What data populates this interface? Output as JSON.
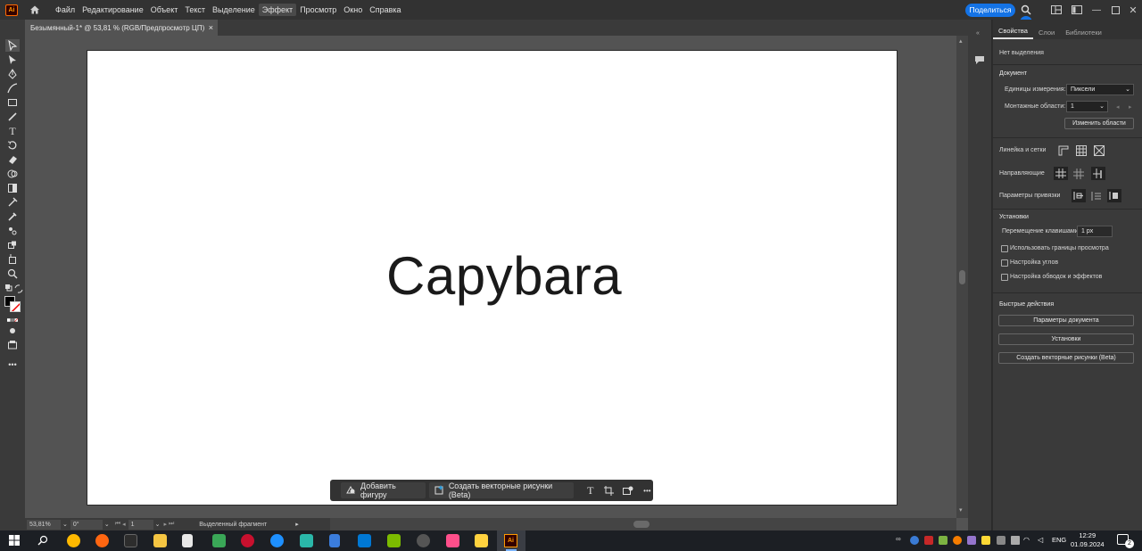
{
  "app": {
    "logo": "Ai",
    "brand_color": "#ff9a00",
    "accent_color": "#1473e6"
  },
  "menu": {
    "items": [
      "Файл",
      "Редактирование",
      "Объект",
      "Текст",
      "Выделение",
      "Эффект",
      "Просмотр",
      "Окно",
      "Справка"
    ],
    "active_item": "Эффект",
    "share_label": "Поделиться"
  },
  "document": {
    "tab_title": "Безымянный-1* @ 53,81 % (RGB/Предпросмотр ЦП)",
    "close_glyph": "×",
    "artboard_text": "Capybara"
  },
  "context_bar": {
    "add_shape_label": "Добавить фигуру",
    "create_vector_label": "Создать векторные рисунки (Beta)",
    "more_glyph": "•••"
  },
  "status_bar": {
    "zoom": "53,81%",
    "rotation": "0°",
    "artboard_number": "1",
    "mode": "Выделенный фрагмент"
  },
  "panel": {
    "tabs": [
      "Свойства",
      "Слои",
      "Библиотеки"
    ],
    "active_tab": "Свойства",
    "no_selection": "Нет выделения",
    "document_header": "Документ",
    "units_label": "Единицы измерения:",
    "units_value": "Пиксели",
    "artboards_label": "Монтажные области:",
    "artboards_value": "1",
    "edit_artboards_button": "Изменить области",
    "rulers_grids_label": "Линейка и сетки",
    "guides_label": "Направляющие",
    "snap_label": "Параметры привязки",
    "prefs_header": "Установки",
    "keyboard_increment_label": "Перемещение клавишами:",
    "keyboard_increment_value": "1 px",
    "checkboxes": [
      "Использовать границы просмотра",
      "Настройка углов",
      "Настройка обводок и эффектов"
    ],
    "quick_actions_header": "Быстрые действия",
    "quick_actions": [
      "Параметры документа",
      "Установки",
      "Создать векторные рисунки (Beta)"
    ]
  },
  "taskbar": {
    "language": "ENG",
    "time": "12:29",
    "date": "01.09.2024",
    "notification_count": "2"
  }
}
